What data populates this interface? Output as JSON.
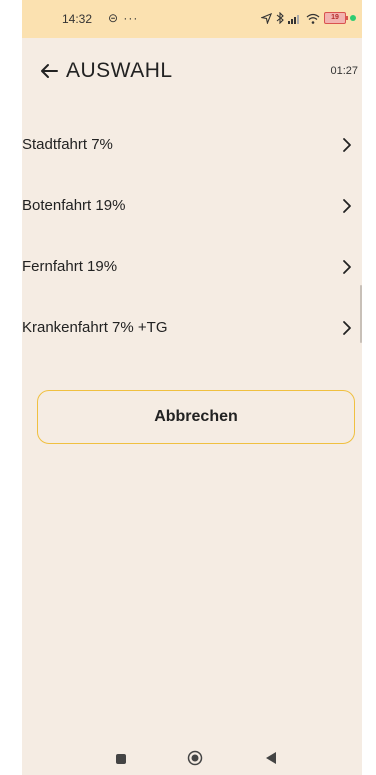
{
  "status_bar": {
    "time": "14:32",
    "extra": "⊝ ···",
    "battery_level": "19",
    "icons": [
      "location-icon",
      "bluetooth-icon",
      "signal-icon",
      "wifi-icon",
      "battery-icon"
    ]
  },
  "header": {
    "title": "AUSWAHL",
    "timer": "01:27",
    "back_icon": "arrow-left-icon"
  },
  "options": [
    {
      "label": "Stadtfahrt 7%"
    },
    {
      "label": "Botenfahrt 19%"
    },
    {
      "label": "Fernfahrt 19%"
    },
    {
      "label": "Krankenfahrt 7% +TG"
    }
  ],
  "cancel_button": {
    "label": "Abbrechen"
  },
  "colors": {
    "background": "#f5ece3",
    "status_bar": "#fbe1b0",
    "button_border": "#f0c040"
  }
}
